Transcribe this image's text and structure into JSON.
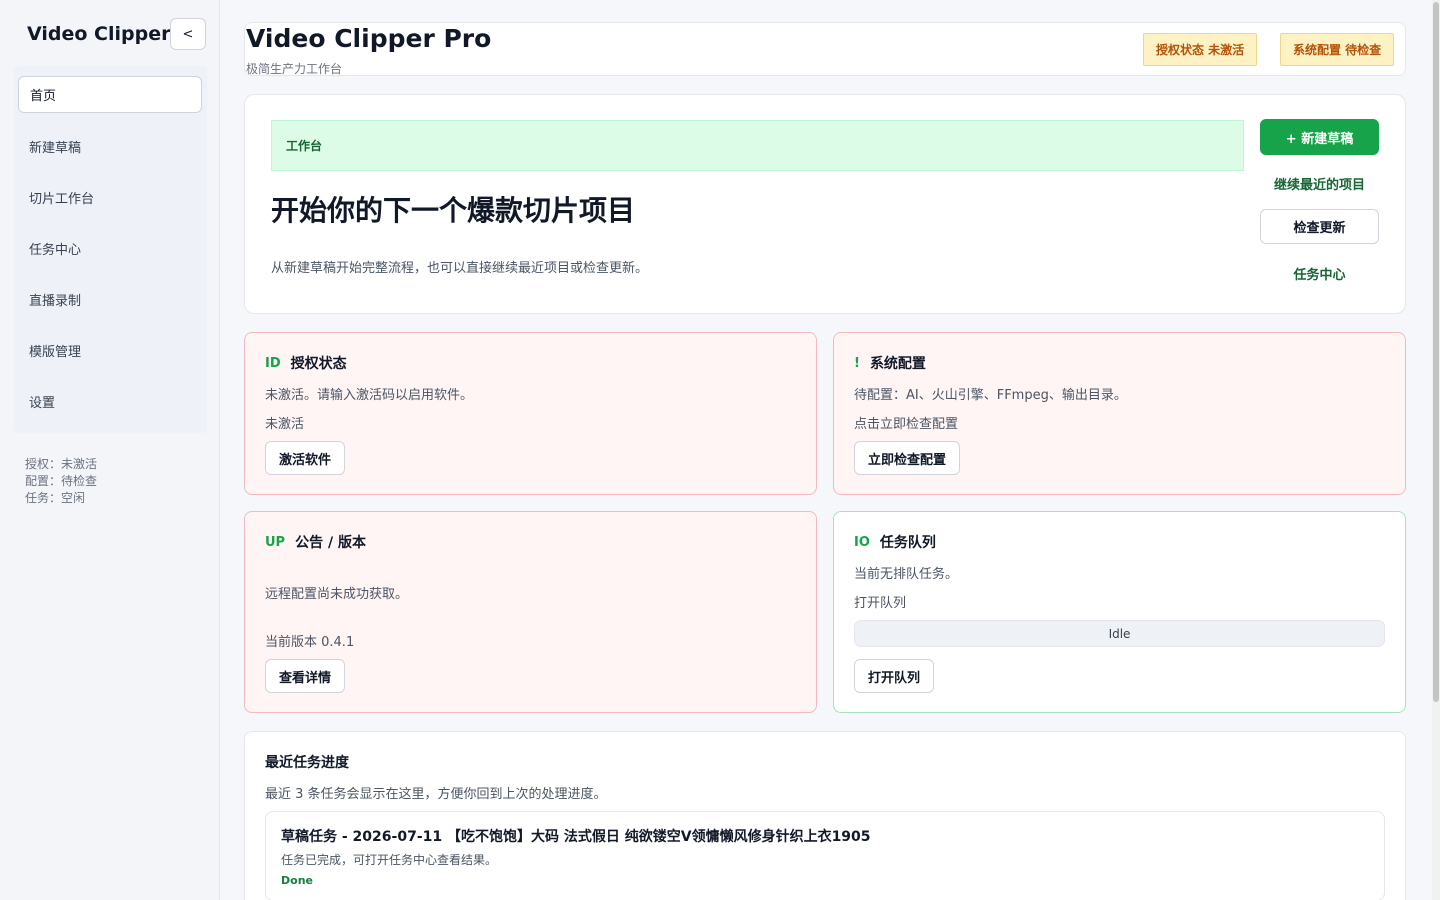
{
  "sidebar": {
    "brand": "Video Clipper",
    "collapse_label": "<",
    "items": [
      {
        "label": "首页"
      },
      {
        "label": "新建草稿"
      },
      {
        "label": "切片工作台"
      },
      {
        "label": "任务中心"
      },
      {
        "label": "直播录制"
      },
      {
        "label": "模版管理"
      },
      {
        "label": "设置"
      }
    ],
    "status": [
      "授权：未激活",
      "配置：待检查",
      "任务：空闲"
    ]
  },
  "header": {
    "title": "Video Clipper Pro",
    "subtitle": "极简生产力工作台",
    "badges": [
      "授权状态  未激活",
      "系统配置  待检查"
    ]
  },
  "hero": {
    "tag": "工作台",
    "title": "开始你的下一个爆款切片项目",
    "desc": "从新建草稿开始完整流程，也可以直接继续最近项目或检查更新。",
    "new_draft": "+ 新建草稿",
    "continue_recent": "继续最近的项目",
    "check_update": "检查更新",
    "task_center": "任务中心"
  },
  "cards": {
    "license": {
      "icon": "ID",
      "title": "授权状态",
      "line1": "未激活。请输入激活码以启用软件。",
      "line2": "未激活",
      "button": "激活软件"
    },
    "config": {
      "icon": "!",
      "title": "系统配置",
      "line1": "待配置：AI、火山引擎、FFmpeg、输出目录。",
      "line2": "点击立即检查配置",
      "button": "立即检查配置"
    },
    "notice": {
      "icon": "UP",
      "title": "公告 / 版本",
      "line1": "远程配置尚未成功获取。",
      "line2": "当前版本 0.4.1",
      "button": "查看详情"
    },
    "queue": {
      "icon": "IO",
      "title": "任务队列",
      "line1": "当前无排队任务。",
      "line2": "打开队列",
      "progress_label": "Idle",
      "button": "打开队列"
    }
  },
  "recent": {
    "title": "最近任务进度",
    "desc": "最近 3 条任务会显示在这里，方便你回到上次的处理进度。",
    "tasks": [
      {
        "title": "草稿任务 - 2026-07-11 【吃不饱饱】大码 法式假日 纯欲镂空V领慵懒风修身针织上衣1905",
        "desc": "任务已完成，可打开任务中心查看结果。",
        "status": "Done"
      }
    ]
  }
}
